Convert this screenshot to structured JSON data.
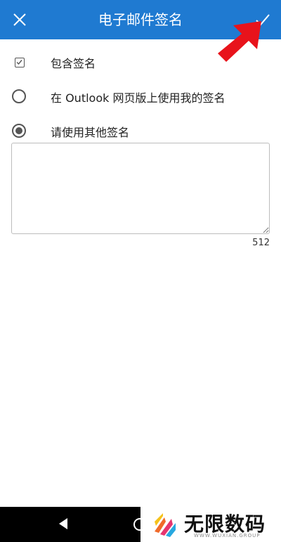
{
  "header": {
    "title": "电子邮件签名",
    "close_icon": "close-icon",
    "confirm_icon": "checkmark-icon",
    "background_color": "#1f7ad1"
  },
  "options": {
    "include_signature": {
      "label": "包含签名",
      "checked": true
    },
    "outlook_web_signature": {
      "label": "在 Outlook 网页版上使用我的签名",
      "selected": false
    },
    "other_signature": {
      "label": "请使用其他签名",
      "selected": true
    }
  },
  "signature_field": {
    "value": "",
    "char_count": "512"
  },
  "overlay": {
    "arrow_color": "#e8131b"
  },
  "watermark": {
    "text": "无限数码",
    "subtext": "WWW.WUXIAN.GROUP"
  }
}
